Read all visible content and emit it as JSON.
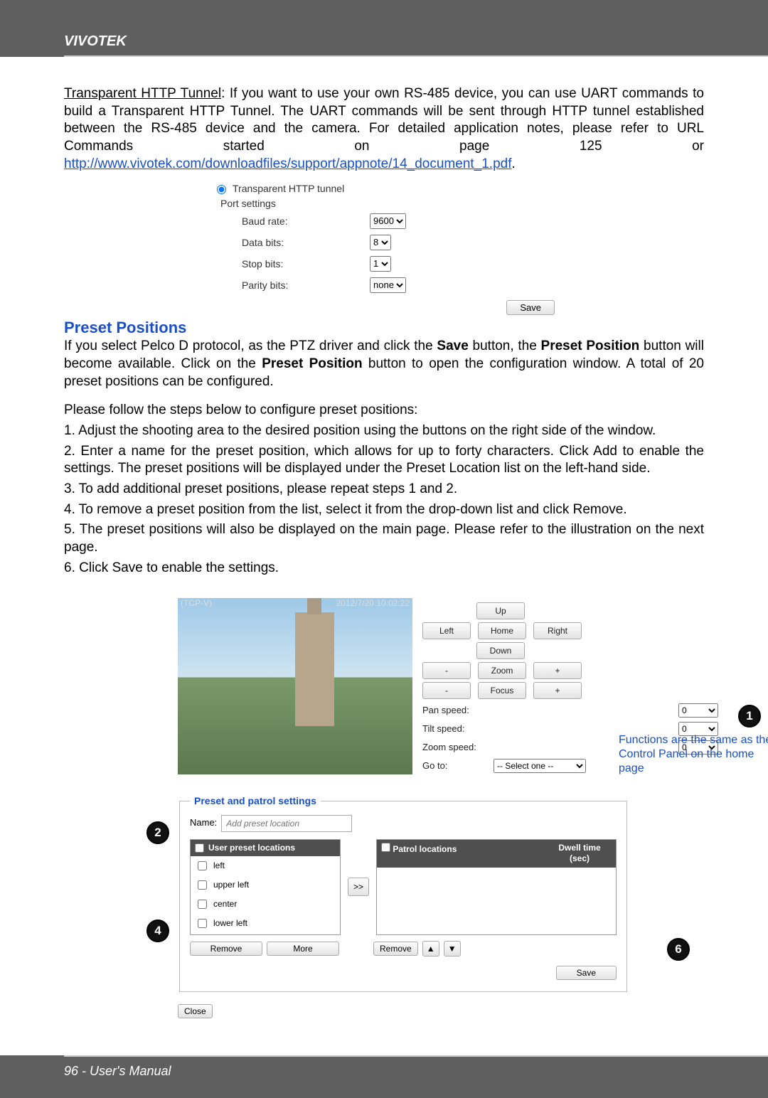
{
  "brand": "VIVOTEK",
  "intro": {
    "tunnel_label": "Transparent HTTP Tunnel",
    "tunnel_text_1": ": If you want to use your own RS-485 device, you can use UART commands to build a Transparent HTTP Tunnel. The UART commands will be sent through HTTP tunnel established between the RS-485 device and the camera. For detailed application notes, please refer to URL Commands started on page 125 or ",
    "link": "http://www.vivotek.com/downloadfiles/support/appnote/14_document_1.pdf",
    "period": "."
  },
  "port": {
    "radio_label": "Transparent HTTP tunnel",
    "settings_label": "Port settings",
    "baud_label": "Baud rate:",
    "baud_value": "9600",
    "data_label": "Data bits:",
    "data_value": "8",
    "stop_label": "Stop bits:",
    "stop_value": "1",
    "parity_label": "Parity bits:",
    "parity_value": "none",
    "save": "Save"
  },
  "section_title": "Preset Positions",
  "para1_a": "If you select Pelco D protocol,  as the PTZ driver and click the ",
  "para1_save": "Save",
  "para1_b": " button, the ",
  "para1_pp": "Preset Position",
  "para1_c": " button will become available. Click on the ",
  "para1_d": " button to open the configuration window. A total of 20 preset positions can be configured.",
  "steps_intro": "Please follow the steps below to configure preset positions:",
  "steps": [
    "1. Adjust the shooting area to the desired position using the buttons on the right side of the window.",
    "2. Enter a name for the preset position, which allows for up to forty characters. Click Add to enable the settings. The preset positions will be displayed under the Preset Location list on the left-hand side.",
    "3. To add additional preset positions, please repeat steps 1 and 2.",
    "4. To remove a preset position from the list, select it from the drop-down list and click Remove.",
    "5. The preset positions will also be displayed on the main page. Please refer to the illustration on the next page.",
    "6. Click Save to enable the settings."
  ],
  "video": {
    "title": "(TCP-V)",
    "timestamp": "2012/7/20 10:02:22"
  },
  "ptz": {
    "up": "Up",
    "left": "Left",
    "home": "Home",
    "right": "Right",
    "down": "Down",
    "minus": "-",
    "zoom": "Zoom",
    "plus": "+",
    "focus": "Focus",
    "pan_label": "Pan speed:",
    "pan_val": "0",
    "tilt_label": "Tilt speed:",
    "tilt_val": "0",
    "zoom_label": "Zoom speed:",
    "zoom_val": "0",
    "goto_label": "Go to:",
    "goto_val": "-- Select one --"
  },
  "note": "Functions are the same as the Control Panel on the home page",
  "fieldset": {
    "legend": "Preset and patrol settings",
    "name_label": "Name:",
    "name_placeholder": "Add preset location",
    "user_presets_header": "User preset locations",
    "patrol_header": "Patrol locations",
    "dwell_header": "Dwell time (sec)",
    "items": [
      "left",
      "upper left",
      "center",
      "lower left"
    ],
    "move": ">>",
    "remove": "Remove",
    "more": "More",
    "remove2": "Remove",
    "up_tri": "▲",
    "down_tri": "▼",
    "save": "Save",
    "close": "Close"
  },
  "badges": {
    "b1": "1",
    "b2": "2",
    "b4": "4",
    "b6": "6"
  },
  "footer": "96 - User's Manual"
}
